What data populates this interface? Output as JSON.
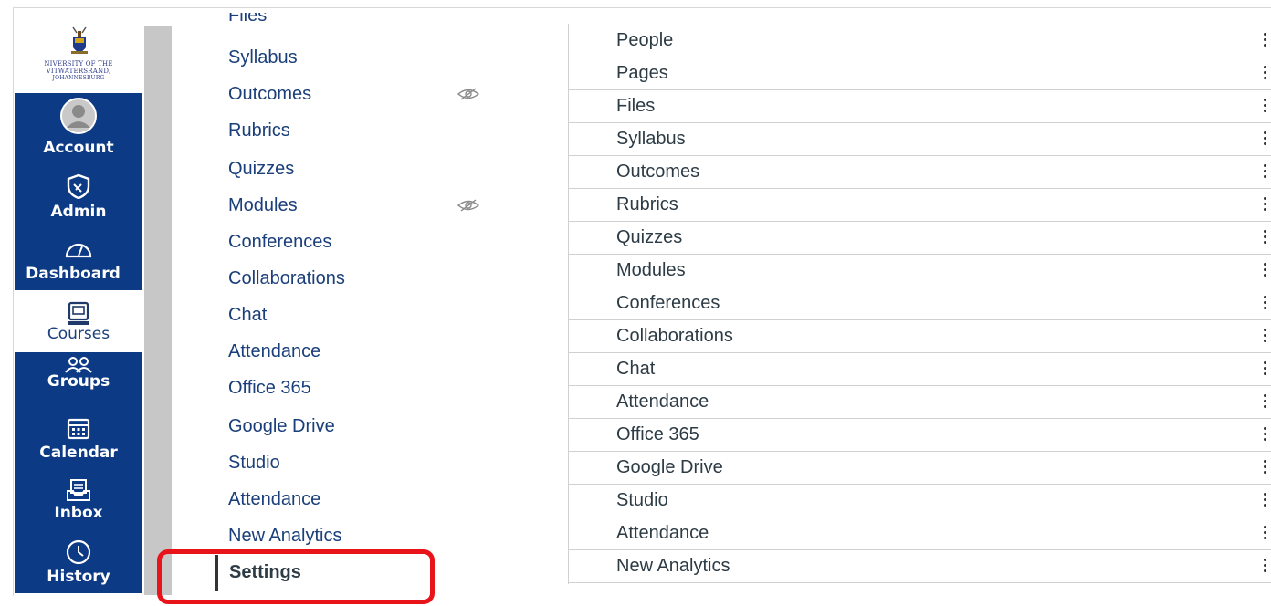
{
  "global_nav": {
    "logo_text_line1": "NIVERSITY OF THE",
    "logo_text_line2": "VITWATERSRAND,",
    "logo_text_line3": "JOHANNESBURG",
    "items": [
      {
        "label": "Account",
        "icon": "user-avatar-icon"
      },
      {
        "label": "Admin",
        "icon": "shield-icon"
      },
      {
        "label": "Dashboard",
        "icon": "dashboard-gauge-icon"
      },
      {
        "label": "Courses",
        "icon": "courses-book-icon"
      },
      {
        "label": "Groups",
        "icon": "groups-people-icon"
      },
      {
        "label": "Calendar",
        "icon": "calendar-icon"
      },
      {
        "label": "Inbox",
        "icon": "inbox-icon"
      },
      {
        "label": "History",
        "icon": "clock-history-icon"
      }
    ],
    "active_item": "Courses",
    "colors": {
      "nav_bg": "#0c3a85",
      "highlight": "#e8141a"
    }
  },
  "course_nav": {
    "items": [
      {
        "label": "Files",
        "hidden": false
      },
      {
        "label": "Syllabus",
        "hidden": false
      },
      {
        "label": "Outcomes",
        "hidden": true
      },
      {
        "label": "Rubrics",
        "hidden": false
      },
      {
        "label": "Quizzes",
        "hidden": false
      },
      {
        "label": "Modules",
        "hidden": true
      },
      {
        "label": "Conferences",
        "hidden": false
      },
      {
        "label": "Collaborations",
        "hidden": false
      },
      {
        "label": "Chat",
        "hidden": false
      },
      {
        "label": "Attendance",
        "hidden": false
      },
      {
        "label": "Office 365",
        "hidden": false
      },
      {
        "label": "Google Drive",
        "hidden": false
      },
      {
        "label": "Studio",
        "hidden": false
      },
      {
        "label": "Attendance",
        "hidden": false
      },
      {
        "label": "New Analytics",
        "hidden": false
      }
    ],
    "active": {
      "label": "Settings"
    }
  },
  "nav_list": {
    "items": [
      {
        "label": "People"
      },
      {
        "label": "Pages"
      },
      {
        "label": "Files"
      },
      {
        "label": "Syllabus"
      },
      {
        "label": "Outcomes"
      },
      {
        "label": "Rubrics"
      },
      {
        "label": "Quizzes"
      },
      {
        "label": "Modules"
      },
      {
        "label": "Conferences"
      },
      {
        "label": "Collaborations"
      },
      {
        "label": "Chat"
      },
      {
        "label": "Attendance"
      },
      {
        "label": "Office 365"
      },
      {
        "label": "Google Drive"
      },
      {
        "label": "Studio"
      },
      {
        "label": "Attendance"
      },
      {
        "label": "New Analytics"
      }
    ],
    "menu_icon": "kebab-menu-icon"
  }
}
